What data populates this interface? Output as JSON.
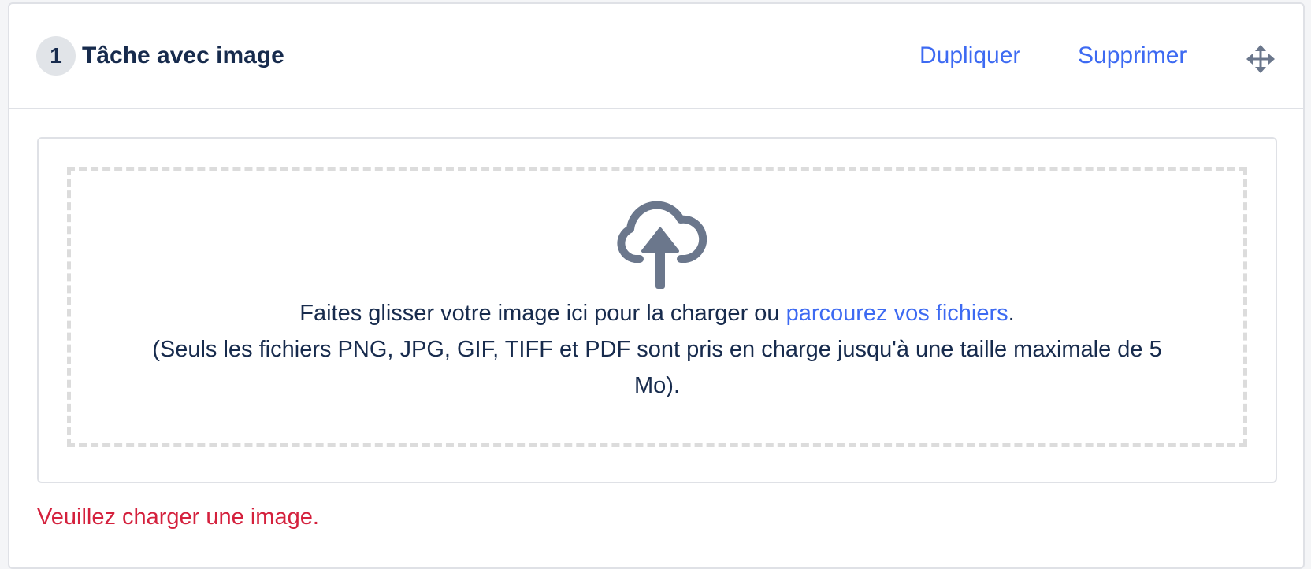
{
  "task": {
    "number": "1",
    "title": "Tâche avec image",
    "duplicate_label": "Dupliquer",
    "delete_label": "Supprimer",
    "move_icon": "move-icon"
  },
  "upload": {
    "icon": "cloud-upload-icon",
    "instruction_prefix": "Faites glisser votre image ici pour la charger ou ",
    "browse_link": "parcourez vos fichiers",
    "instruction_suffix": ".",
    "note": "(Seuls les fichiers PNG, JPG, GIF, TIFF et PDF sont pris en charge jusqu'à une taille maximale de 5 Mo)."
  },
  "error": {
    "message": "Veuillez charger une image."
  },
  "colors": {
    "link": "#3d6af2",
    "text": "#172b4d",
    "error": "#d4213d",
    "icon": "#6b778c",
    "dashed_border": "#dcdcdc"
  }
}
